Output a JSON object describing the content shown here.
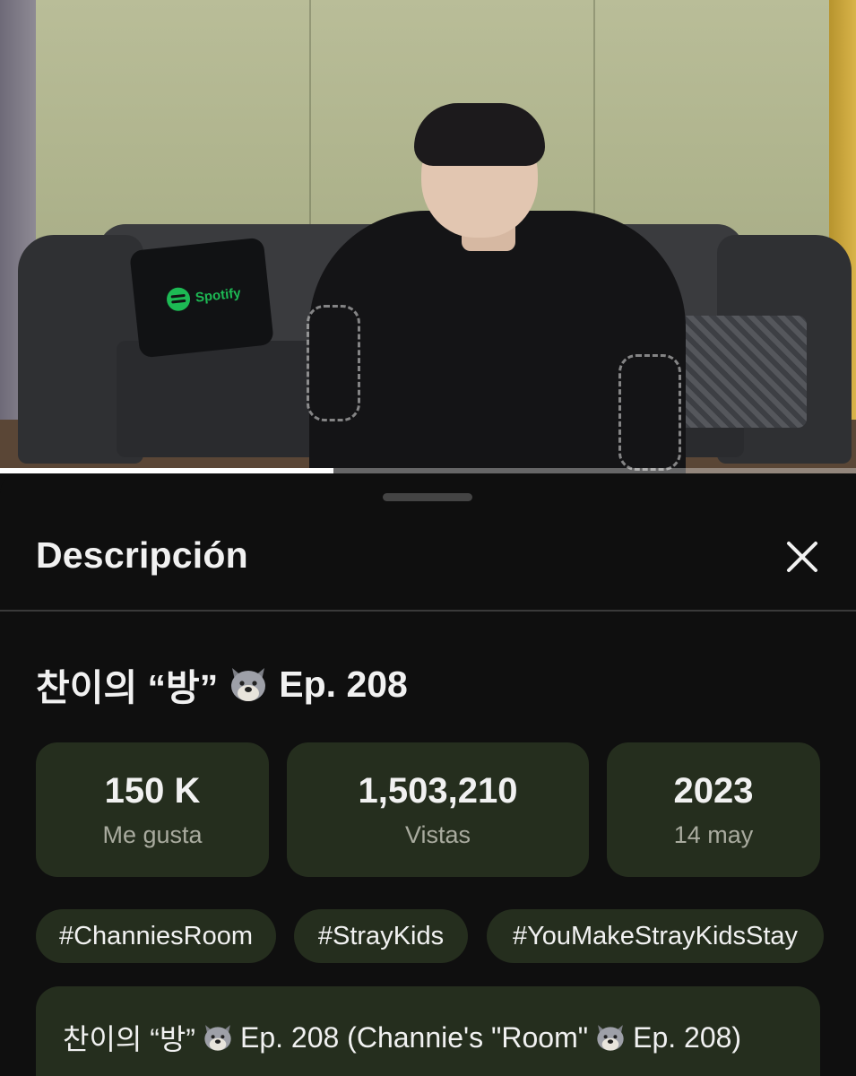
{
  "video": {
    "progress_fraction": 0.39,
    "pillow_text": "Spotify"
  },
  "sheet": {
    "title": "Descripción",
    "close_icon": "close-icon",
    "video_title_prefix": "찬이의 “방”",
    "video_title_emoji": "wolf-face-emoji",
    "video_title_suffix": "Ep. 208",
    "stats": [
      {
        "value": "150 K",
        "label": "Me gusta"
      },
      {
        "value": "1,503,210",
        "label": "Vistas"
      },
      {
        "value": "2023",
        "label": "14 may"
      }
    ],
    "hashtags": [
      "#ChanniesRoom",
      "#StrayKids",
      "#YouMakeStrayKidsStay"
    ],
    "description": {
      "part1": "찬이의 “방”",
      "part2": "Ep. 208 (Channie's \"Room\"",
      "part3": "Ep. 208)"
    }
  },
  "colors": {
    "background": "#0f0f0f",
    "chip": "#252e1e",
    "secondary_text": "#a9ab9f",
    "spotify_green": "#1db954"
  }
}
